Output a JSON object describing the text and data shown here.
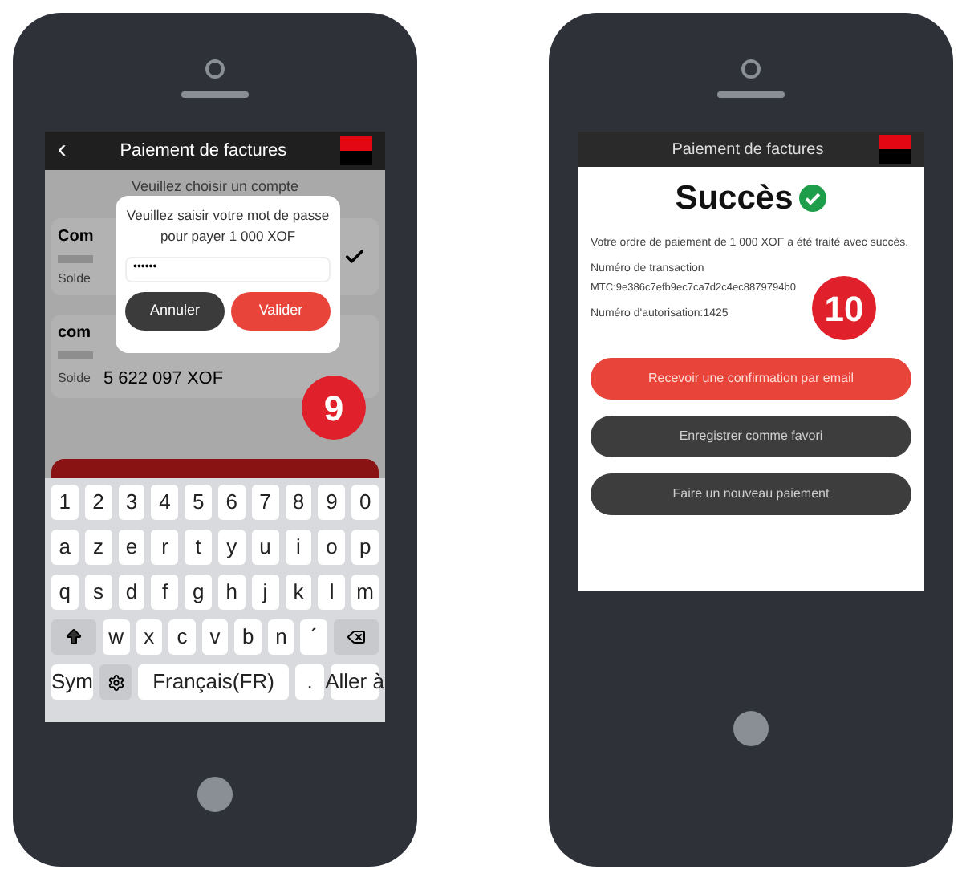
{
  "phones": [
    {
      "kind": "password",
      "header": {
        "back": "‹",
        "title": "Paiement de factures"
      },
      "prompt": "Veuillez choisir un compte",
      "accounts": [
        {
          "name": "Com",
          "balance_label": "Solde",
          "selected": true
        },
        {
          "name": "com",
          "balance_label": "Solde",
          "balance": "5 622 097 XOF",
          "selected": false
        }
      ],
      "dialog": {
        "message": "Veuillez saisir votre mot de passe pour payer 1 000 XOF",
        "value": "••••••",
        "buttons": [
          {
            "label": "Annuler",
            "kind": "secondary"
          },
          {
            "label": "Valider",
            "kind": "primary"
          }
        ]
      },
      "keyboard": [
        [
          "1",
          "2",
          "3",
          "4",
          "5",
          "6",
          "7",
          "8",
          "9",
          "0"
        ],
        [
          "a",
          "z",
          "e",
          "r",
          "t",
          "y",
          "u",
          "i",
          "o",
          "p"
        ],
        [
          "q",
          "s",
          "d",
          "f",
          "g",
          "h",
          "j",
          "k",
          "l",
          "m"
        ],
        [
          "w",
          "x",
          "c",
          "v",
          "b",
          "n",
          "´"
        ]
      ],
      "keyboard_bottom": {
        "sym": "Sym",
        "space": "Français(FR)",
        "dot": ".",
        "go": "Aller à"
      },
      "step": "9"
    },
    {
      "kind": "success",
      "header": {
        "title": "Paiement de factures"
      },
      "heading": "Succès",
      "message": "Votre ordre de paiement de 1 000 XOF a été traité avec succès.",
      "transaction_label": "Numéro de transaction",
      "transaction": "MTC:9e386c7efb9ec7ca7d2c4ec8879794b0",
      "authorization": "Numéro d'autorisation:1425",
      "buttons": [
        {
          "label": "Recevoir une confirmation par email",
          "kind": "primary"
        },
        {
          "label": "Enregistrer comme favori",
          "kind": "secondary"
        },
        {
          "label": "Faire un nouveau paiement",
          "kind": "secondary"
        }
      ],
      "step": "10"
    }
  ]
}
